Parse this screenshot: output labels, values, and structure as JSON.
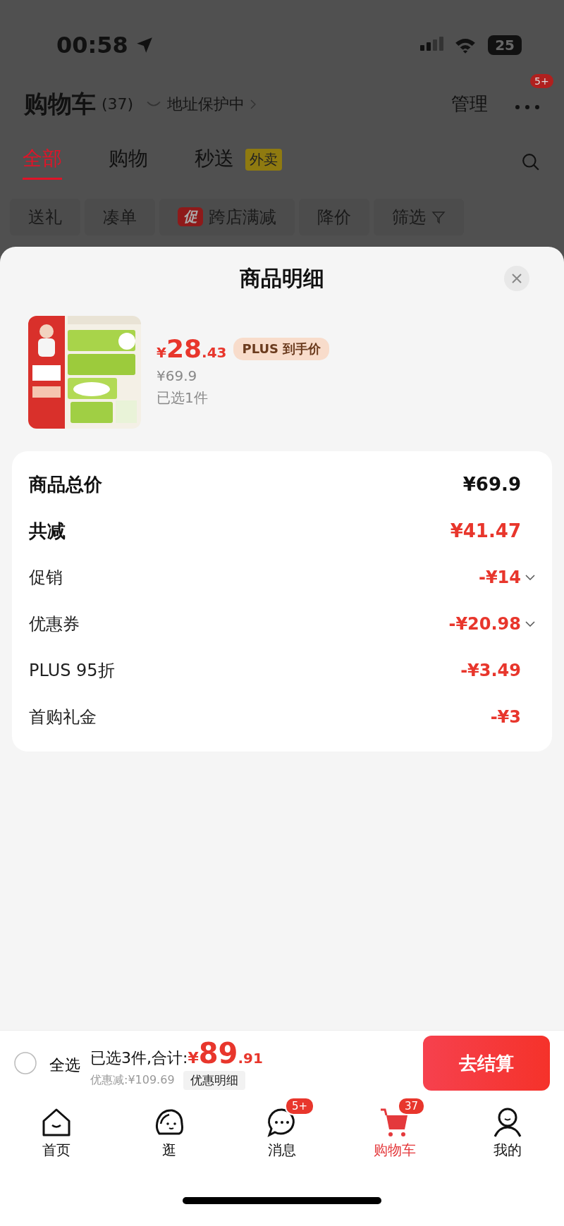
{
  "status_bar": {
    "time": "00:58",
    "battery": "25"
  },
  "header": {
    "title": "购物车",
    "count": "(37)",
    "address": "地址保护中",
    "manage": "管理",
    "more_badge": "5+"
  },
  "tabs": [
    {
      "label": "全部",
      "selected": true
    },
    {
      "label": "购物",
      "selected": false
    },
    {
      "label": "秒送",
      "selected": false,
      "tag": "外卖"
    }
  ],
  "filters": [
    {
      "label": "送礼"
    },
    {
      "label": "凑单"
    },
    {
      "label": "跨店满减",
      "tag": "促"
    },
    {
      "label": "降价"
    },
    {
      "label": "筛选",
      "kind": "filter"
    }
  ],
  "sheet": {
    "title": "商品明细",
    "product": {
      "kind": "picture",
      "currency": "¥",
      "price_int": "28",
      "price_dec": ".43",
      "price_tag": "PLUS 到手价",
      "original_price": "¥69.9",
      "selected_count": "已选1件"
    },
    "breakdown": [
      {
        "label": "商品总价",
        "value": "¥69.9",
        "kind": "total",
        "expandable": false
      },
      {
        "label": "共减",
        "value": "¥41.47",
        "kind": "discount_total",
        "expandable": false
      },
      {
        "label": "促销",
        "value": "-¥14",
        "kind": "discount",
        "expandable": true
      },
      {
        "label": "优惠券",
        "value": "-¥20.98",
        "kind": "discount",
        "expandable": true
      },
      {
        "label": "PLUS 95折",
        "value": "-¥3.49",
        "kind": "discount",
        "expandable": false
      },
      {
        "label": "首购礼金",
        "value": "-¥3",
        "kind": "discount",
        "expandable": false
      }
    ]
  },
  "footer": {
    "select_all": {
      "label": "全选",
      "checked": false
    },
    "summary": "已选3件,合计:",
    "currency": "¥",
    "total_int": "89",
    "total_dec": ".91",
    "saved": "优惠减:¥109.69",
    "detail_button": "优惠明细",
    "checkout": "去结算"
  },
  "nav": [
    {
      "label": "首页",
      "kind": "home",
      "selected": false
    },
    {
      "label": "逛",
      "kind": "browse",
      "selected": false
    },
    {
      "label": "消息",
      "kind": "message",
      "selected": false,
      "badge": "5+"
    },
    {
      "label": "购物车",
      "kind": "cart",
      "selected": true,
      "badge": "37"
    },
    {
      "label": "我的",
      "kind": "profile",
      "selected": false
    }
  ]
}
